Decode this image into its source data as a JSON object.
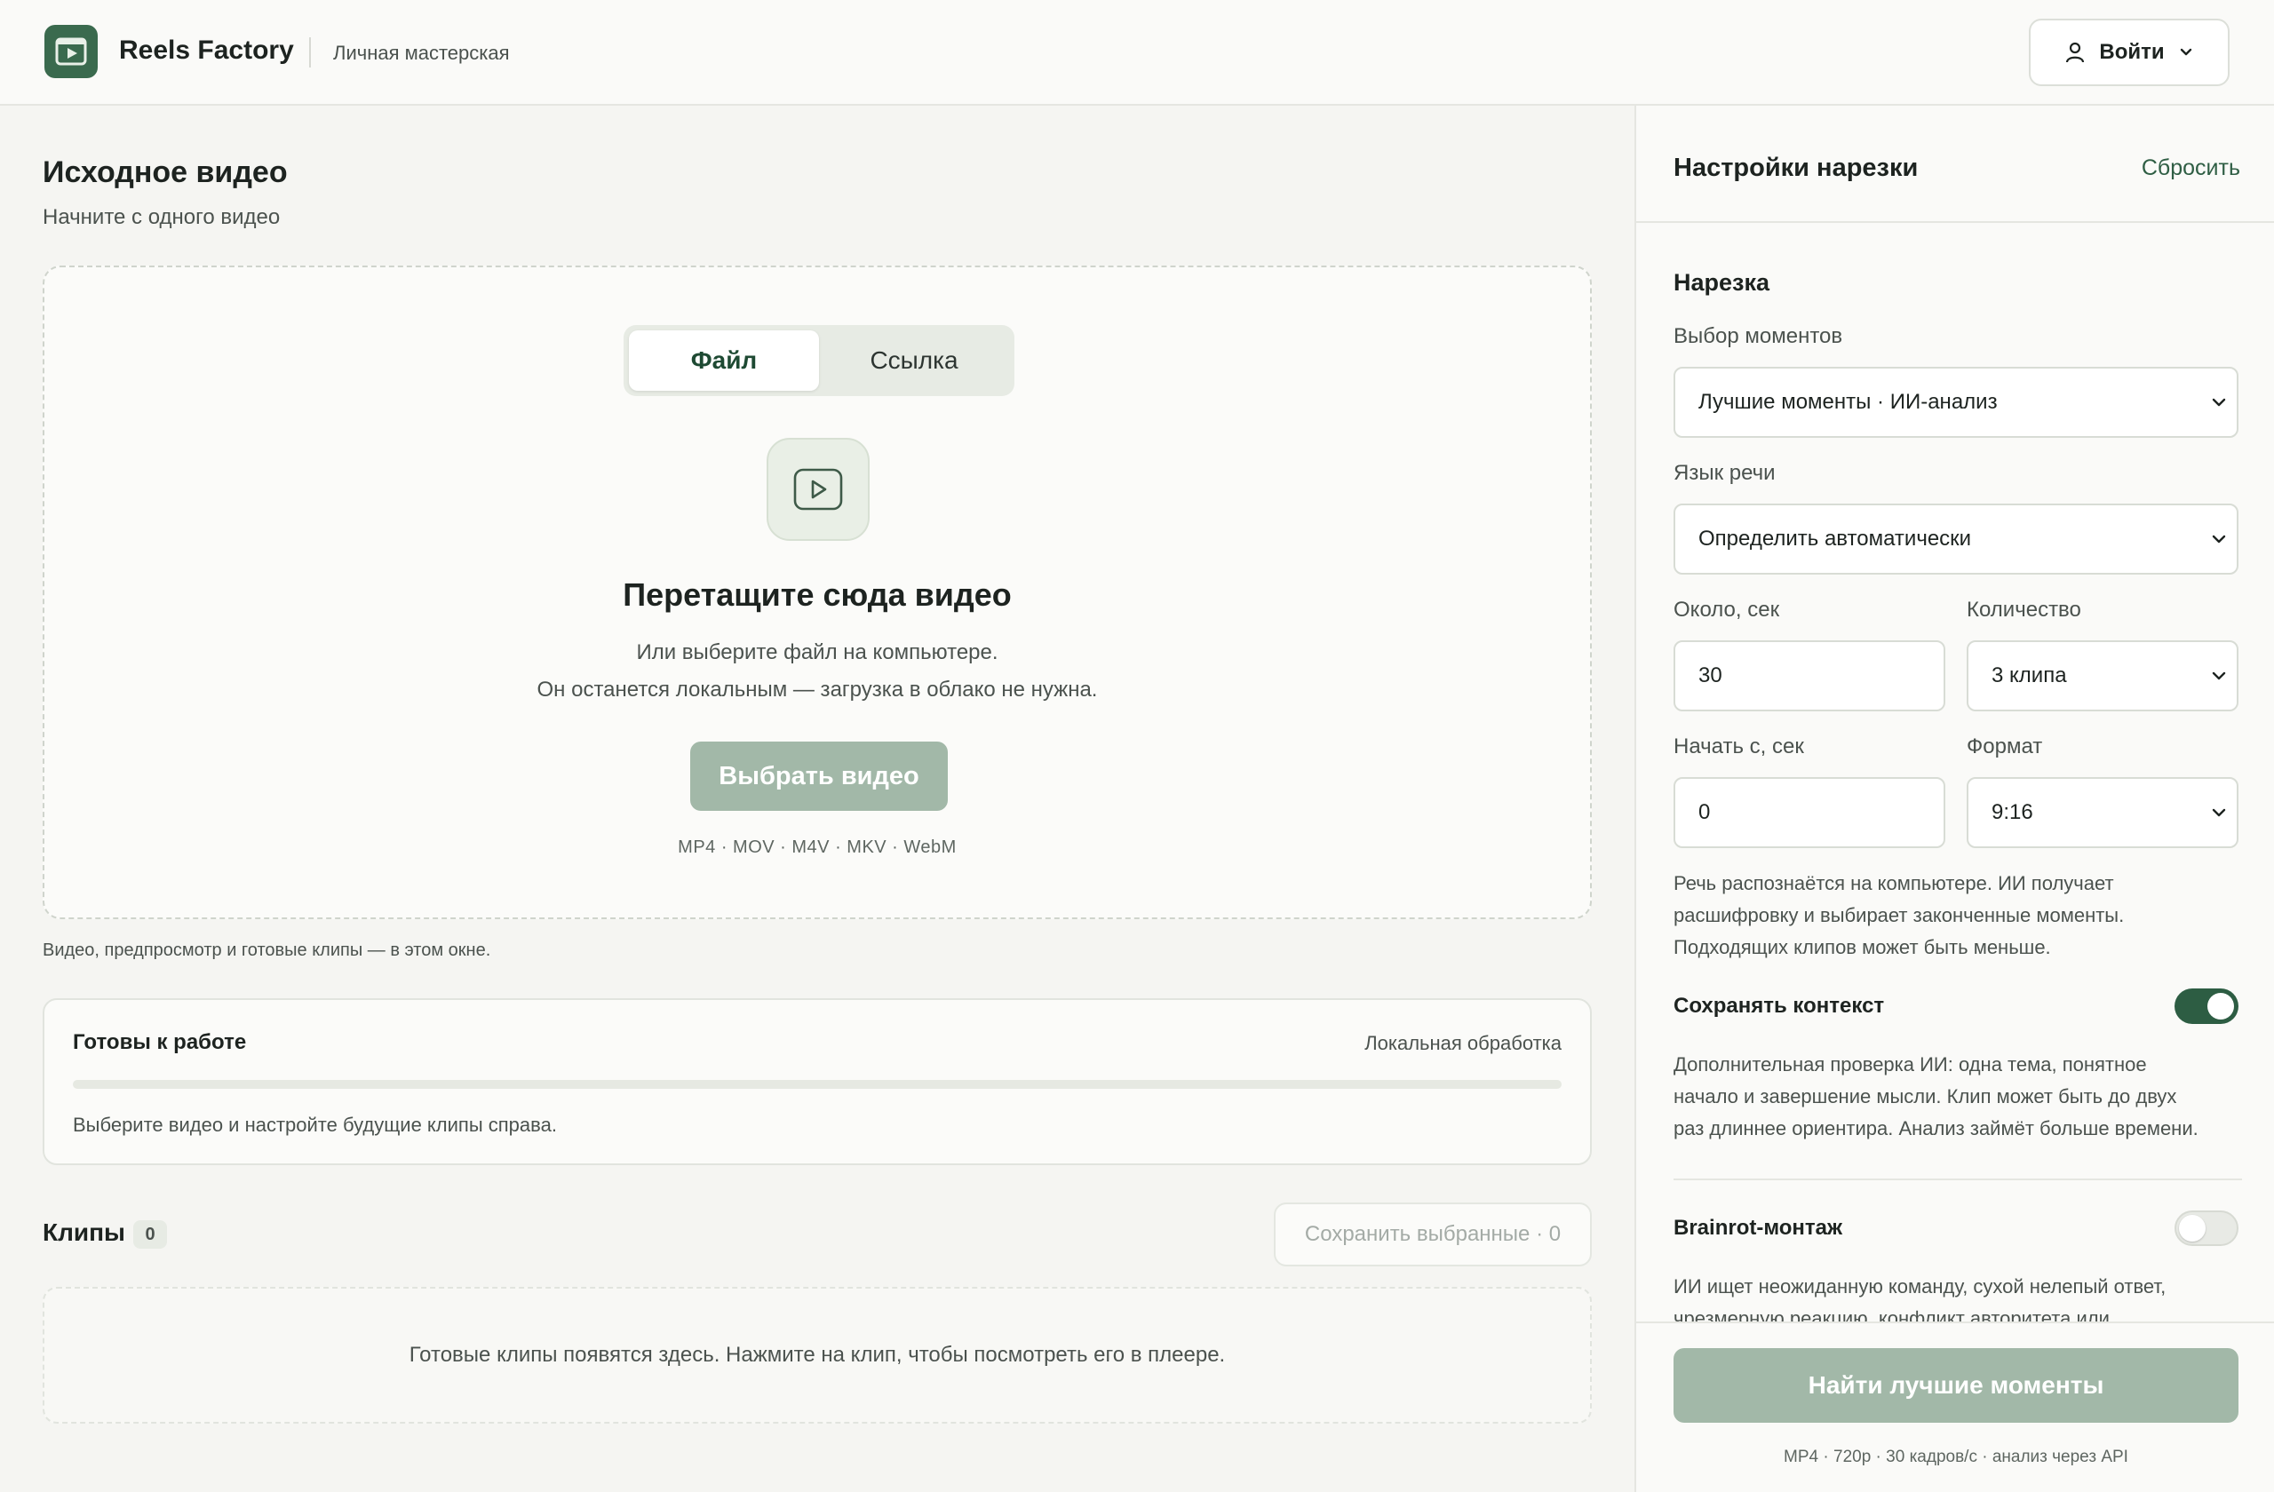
{
  "header": {
    "brand": "Reels Factory",
    "subtitle": "Личная мастерская",
    "login_label": "Войти",
    "icons": {
      "logo": "video-play-logo-icon",
      "user": "user-icon",
      "chevron": "chevron-down-icon"
    }
  },
  "source": {
    "title": "Исходное видео",
    "subtitle": "Начните с одного видео",
    "tabs": [
      {
        "label": "Файл",
        "active": true
      },
      {
        "label": "Ссылка",
        "active": false
      }
    ],
    "drop_title": "Перетащите сюда видео",
    "drop_line1": "Или выберите файл на компьютере.",
    "drop_line2": "Он останется локальным — загрузка в облако не нужна.",
    "choose_label": "Выбрать видео",
    "formats": "MP4 · MOV · M4V · MKV · WebM",
    "note": "Видео, предпросмотр и готовые клипы — в этом окне."
  },
  "status": {
    "title": "Готовы к работе",
    "mode": "Локальная обработка",
    "progress": 0,
    "hint": "Выберите видео и настройте будущие клипы справа."
  },
  "clips": {
    "title": "Клипы",
    "count": "0",
    "save_label": "Сохранить выбранные · 0",
    "empty_text": "Готовые клипы появятся здесь. Нажмите на клип, чтобы посмотреть его в плеере."
  },
  "settings": {
    "title": "Настройки нарезки",
    "reset_label": "Сбросить",
    "section_title": "Нарезка",
    "moments_label": "Выбор моментов",
    "moments_value": "Лучшие моменты · ИИ-анализ",
    "language_label": "Язык речи",
    "language_value": "Определить автоматически",
    "duration_label": "Около, сек",
    "duration_value": "30",
    "count_label": "Количество",
    "count_value": "3 клипа",
    "start_label": "Начать с, сек",
    "start_value": "0",
    "format_label": "Формат",
    "format_value": "9:16",
    "speech_note_1": "Речь распознаётся на компьютере. ИИ получает",
    "speech_note_2": "расшифровку и выбирает законченные моменты.",
    "speech_note_3": "Подходящих клипов может быть меньше.",
    "context_label": "Сохранять контекст",
    "context_on": true,
    "context_note_1": "Дополнительная проверка ИИ: одна тема, понятное",
    "context_note_2": "начало и завершение мысли. Клип может быть до двух",
    "context_note_3": "раз длиннее ориентира. Анализ займёт больше времени.",
    "brainrot_label": "Brainrot-монтаж",
    "brainrot_on": false,
    "brainrot_note_1": "ИИ ищет неожиданную команду, сухой нелепый ответ,",
    "brainrot_note_2": "чрезмерную реакцию, конфликт авторитета или",
    "find_label": "Найти лучшие моменты",
    "footer_meta": "MP4 · 720p · 30 кадров/с · анализ через API"
  },
  "colors": {
    "accent": "#2d5d43",
    "accent_muted": "#a2b8a8",
    "background": "#f5f5f2"
  }
}
